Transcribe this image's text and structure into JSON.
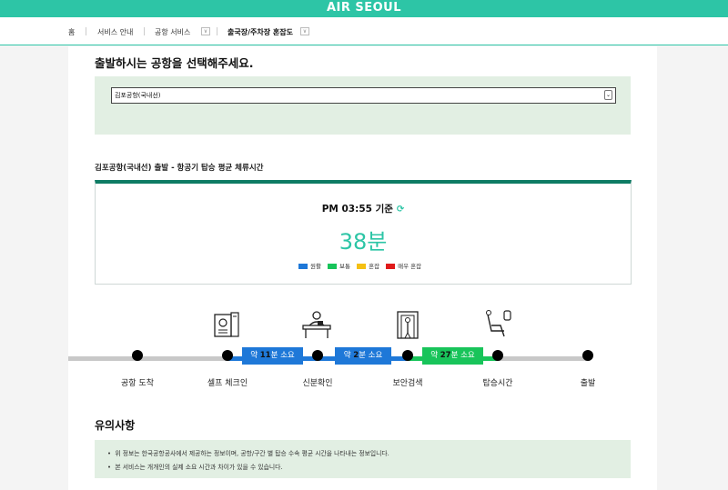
{
  "header": {
    "brand": "AIR SEOUL"
  },
  "nav": {
    "home": "홈",
    "service_info": "서비스 안내",
    "airport_service": "공항 서비스",
    "congestion": "출국장/주차장 혼잡도"
  },
  "main": {
    "heading": "출발하시는 공항을 선택해주세요.",
    "airport_select": {
      "value": "김포공항(국내선)"
    },
    "subtitle": "김포공항(국내선) 출발 - 항공기 탑승 평균 체류시간",
    "time_label": "PM 03:55 기준",
    "total_minutes": "38분",
    "legend": [
      {
        "label": "원활",
        "color": "#1e78d8"
      },
      {
        "label": "보통",
        "color": "#18c45a"
      },
      {
        "label": "혼잡",
        "color": "#f5c013"
      },
      {
        "label": "매우 혼잡",
        "color": "#e01b1b"
      }
    ]
  },
  "process": {
    "stages": [
      "공항 도착",
      "셀프 체크인",
      "신분확인",
      "보안검색",
      "탑승시간",
      "출발"
    ],
    "segments": [
      {
        "prefix": "약 ",
        "minutes": "11",
        "suffix": "분 소요",
        "color": "#1e78d8"
      },
      {
        "prefix": "약 ",
        "minutes": "2",
        "suffix": "분 소요",
        "color": "#1e78d8"
      },
      {
        "prefix": "약 ",
        "minutes": "27",
        "suffix": "분 소요",
        "color": "#18c45a"
      }
    ]
  },
  "notes": {
    "title": "유의사항",
    "items": [
      "위 정보는 한국공항공사에서 제공하는 정보이며, 공항/구간 별 탑승 수속 평균 시간을 나타내는 정보입니다.",
      "본 서비스는 개개인의 실제 소요 시간과 차이가 있을 수 있습니다."
    ]
  }
}
